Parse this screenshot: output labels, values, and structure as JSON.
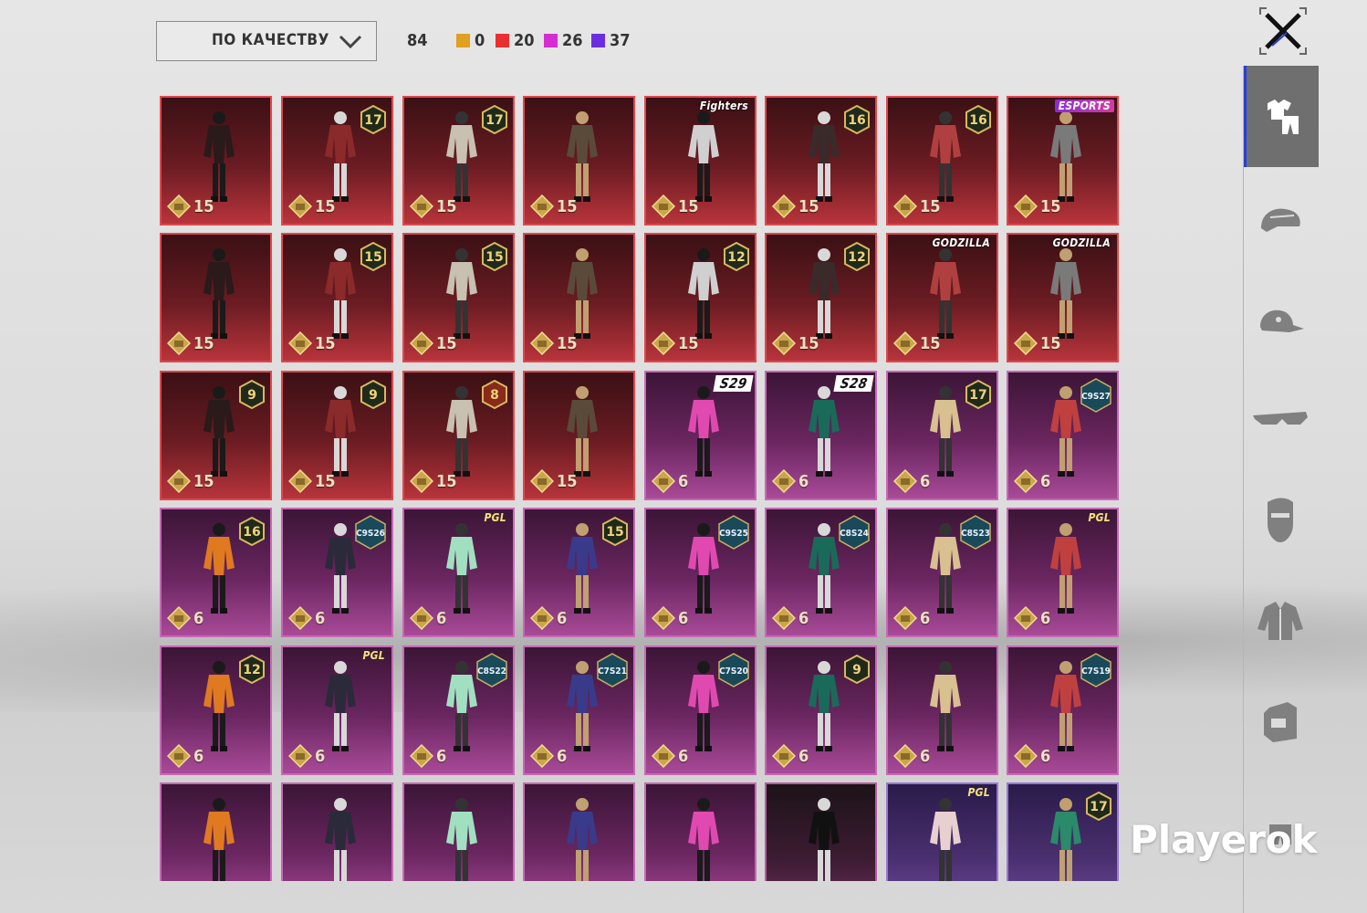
{
  "toolbar": {
    "sort_label": "ПО КАЧЕСТВУ",
    "total_count": "84",
    "rarity_counts": [
      {
        "color": "#e0a020",
        "count": "0"
      },
      {
        "color": "#e83030",
        "count": "20"
      },
      {
        "color": "#d42ed0",
        "count": "26"
      },
      {
        "color": "#6a2ee0",
        "count": "37"
      }
    ]
  },
  "sidebar": {
    "tabs": [
      {
        "icon": "outfit-icon",
        "active": true
      },
      {
        "icon": "helmet-icon",
        "active": false
      },
      {
        "icon": "cap-icon",
        "active": false
      },
      {
        "icon": "glasses-icon",
        "active": false
      },
      {
        "icon": "mask-icon",
        "active": false
      },
      {
        "icon": "jacket-icon",
        "active": false
      },
      {
        "icon": "backpack-icon",
        "active": false
      },
      {
        "icon": "pants-icon",
        "active": false
      }
    ]
  },
  "items": [
    {
      "rarity": "red",
      "price": "15",
      "tag_type": "none",
      "tag": "",
      "owned": true
    },
    {
      "rarity": "red",
      "price": "15",
      "tag_type": "level",
      "tag": "17"
    },
    {
      "rarity": "red",
      "price": "15",
      "tag_type": "level",
      "tag": "17",
      "owned": true
    },
    {
      "rarity": "red",
      "price": "15",
      "tag_type": "none",
      "tag": ""
    },
    {
      "rarity": "red",
      "price": "15",
      "tag_type": "kof",
      "tag": "Fighters",
      "owned": true
    },
    {
      "rarity": "red",
      "price": "15",
      "tag_type": "level",
      "tag": "16",
      "owned": true
    },
    {
      "rarity": "red",
      "price": "15",
      "tag_type": "level",
      "tag": "16",
      "owned": true
    },
    {
      "rarity": "red",
      "price": "15",
      "tag_type": "esports",
      "tag": "ESPORTS"
    },
    {
      "rarity": "red",
      "price": "15",
      "tag_type": "none",
      "tag": ""
    },
    {
      "rarity": "red",
      "price": "15",
      "tag_type": "level",
      "tag": "15"
    },
    {
      "rarity": "red",
      "price": "15",
      "tag_type": "level",
      "tag": "15"
    },
    {
      "rarity": "red",
      "price": "15",
      "tag_type": "none",
      "tag": ""
    },
    {
      "rarity": "red",
      "price": "15",
      "tag_type": "level",
      "tag": "12"
    },
    {
      "rarity": "red",
      "price": "15",
      "tag_type": "level",
      "tag": "12"
    },
    {
      "rarity": "red",
      "price": "15",
      "tag_type": "plain",
      "tag": "GODZILLA"
    },
    {
      "rarity": "red",
      "price": "15",
      "tag_type": "plain",
      "tag": "GODZILLA"
    },
    {
      "rarity": "red",
      "price": "15",
      "tag_type": "level",
      "tag": "9"
    },
    {
      "rarity": "red",
      "price": "15",
      "tag_type": "level",
      "tag": "9"
    },
    {
      "rarity": "red",
      "price": "15",
      "tag_type": "level8",
      "tag": "8"
    },
    {
      "rarity": "red",
      "price": "15",
      "tag_type": "none",
      "tag": ""
    },
    {
      "rarity": "purple",
      "price": "6",
      "tag_type": "season",
      "tag": "S29"
    },
    {
      "rarity": "purple",
      "price": "6",
      "tag_type": "season",
      "tag": "S28"
    },
    {
      "rarity": "purple",
      "price": "6",
      "tag_type": "level",
      "tag": "17"
    },
    {
      "rarity": "purple",
      "price": "6",
      "tag_type": "hex",
      "tag": "C9S27"
    },
    {
      "rarity": "purple",
      "price": "6",
      "tag_type": "level",
      "tag": "16"
    },
    {
      "rarity": "purple",
      "price": "6",
      "tag_type": "hex",
      "tag": "C9S26"
    },
    {
      "rarity": "purple",
      "price": "6",
      "tag_type": "pgl",
      "tag": "PGL"
    },
    {
      "rarity": "purple",
      "price": "6",
      "tag_type": "level",
      "tag": "15"
    },
    {
      "rarity": "purple",
      "price": "6",
      "tag_type": "hex",
      "tag": "C9S25"
    },
    {
      "rarity": "purple",
      "price": "6",
      "tag_type": "hex",
      "tag": "C8S24"
    },
    {
      "rarity": "purple",
      "price": "6",
      "tag_type": "hex",
      "tag": "C8S23"
    },
    {
      "rarity": "purple",
      "price": "6",
      "tag_type": "pgl",
      "tag": "PGL"
    },
    {
      "rarity": "purple",
      "price": "6",
      "tag_type": "level",
      "tag": "12"
    },
    {
      "rarity": "purple",
      "price": "6",
      "tag_type": "pgl",
      "tag": "PGL"
    },
    {
      "rarity": "purple",
      "price": "6",
      "tag_type": "hex",
      "tag": "C8S22"
    },
    {
      "rarity": "purple",
      "price": "6",
      "tag_type": "hex",
      "tag": "C7S21"
    },
    {
      "rarity": "purple",
      "price": "6",
      "tag_type": "hex",
      "tag": "C7S20"
    },
    {
      "rarity": "purple",
      "price": "6",
      "tag_type": "level",
      "tag": "9"
    },
    {
      "rarity": "purple",
      "price": "6",
      "tag_type": "none",
      "tag": ""
    },
    {
      "rarity": "purple",
      "price": "6",
      "tag_type": "hex",
      "tag": "C7S19"
    },
    {
      "rarity": "purple",
      "price": "",
      "tag_type": "none",
      "tag": ""
    },
    {
      "rarity": "purple",
      "price": "",
      "tag_type": "none",
      "tag": ""
    },
    {
      "rarity": "purple",
      "price": "",
      "tag_type": "none",
      "tag": ""
    },
    {
      "rarity": "purple",
      "price": "",
      "tag_type": "none",
      "tag": ""
    },
    {
      "rarity": "purple",
      "price": "",
      "tag_type": "none",
      "tag": ""
    },
    {
      "rarity": "dark",
      "price": "",
      "tag_type": "none",
      "tag": ""
    },
    {
      "rarity": "violet",
      "price": "",
      "tag_type": "pgl",
      "tag": "PGL"
    },
    {
      "rarity": "violet",
      "price": "",
      "tag_type": "level",
      "tag": "17"
    }
  ],
  "watermark": "Playerok"
}
